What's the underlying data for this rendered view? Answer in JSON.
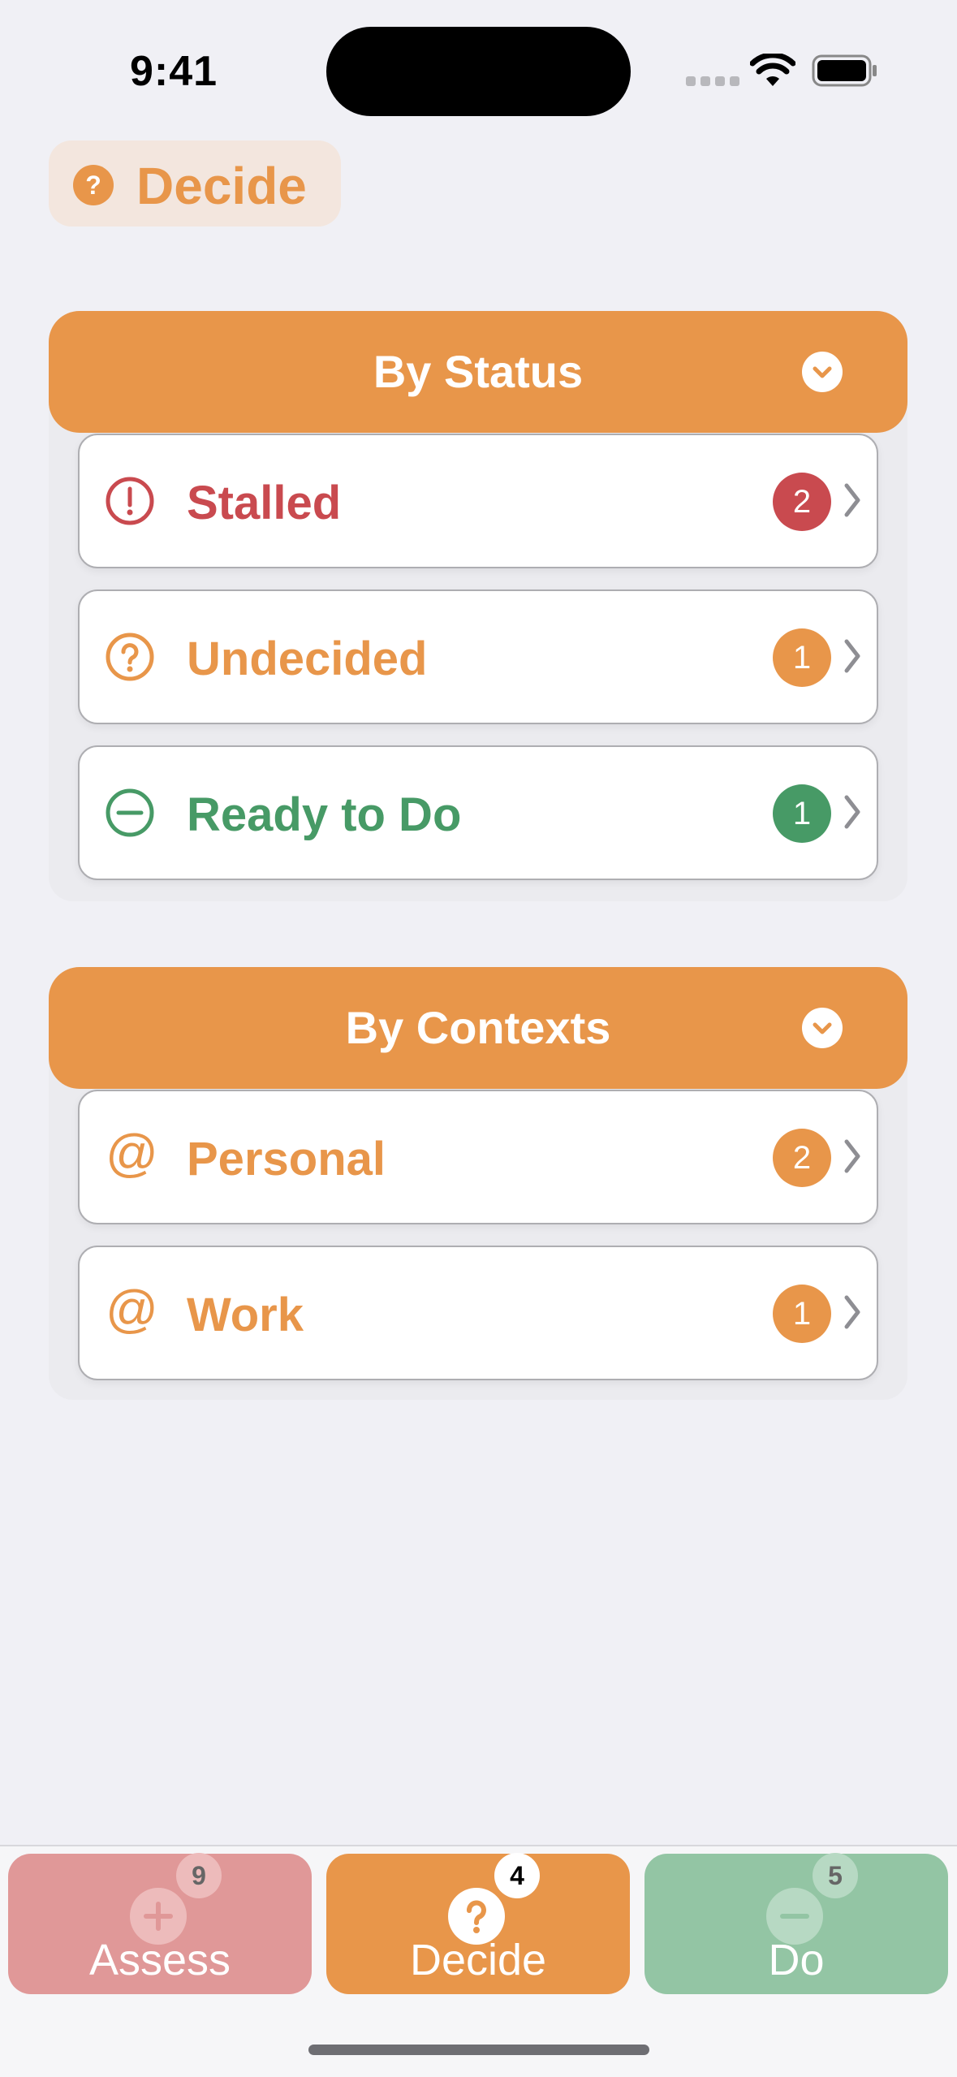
{
  "status_bar": {
    "time": "9:41"
  },
  "header": {
    "title": "Decide",
    "title_icon": "question-mark"
  },
  "colors": {
    "accent": "#E8964A",
    "stalled": "#C94A4F",
    "ready": "#479A66",
    "assess_tab": "#E09898",
    "do_tab": "#93C5A4",
    "background": "#F0F0F5"
  },
  "sections": {
    "status": {
      "title": "By Status",
      "items": [
        {
          "label": "Stalled",
          "count": "2",
          "icon": "exclamation-circle"
        },
        {
          "label": "Undecided",
          "count": "1",
          "icon": "question-circle"
        },
        {
          "label": "Ready to Do",
          "count": "1",
          "icon": "minus-circle"
        }
      ]
    },
    "contexts": {
      "title": "By Contexts",
      "items": [
        {
          "label": "Personal",
          "count": "2",
          "icon": "at-sign"
        },
        {
          "label": "Work",
          "count": "1",
          "icon": "at-sign"
        }
      ]
    }
  },
  "tabs": [
    {
      "label": "Assess",
      "count": "9",
      "icon": "plus-circle"
    },
    {
      "label": "Decide",
      "count": "4",
      "icon": "question-circle",
      "selected": true
    },
    {
      "label": "Do",
      "count": "5",
      "icon": "minus-circle"
    }
  ]
}
